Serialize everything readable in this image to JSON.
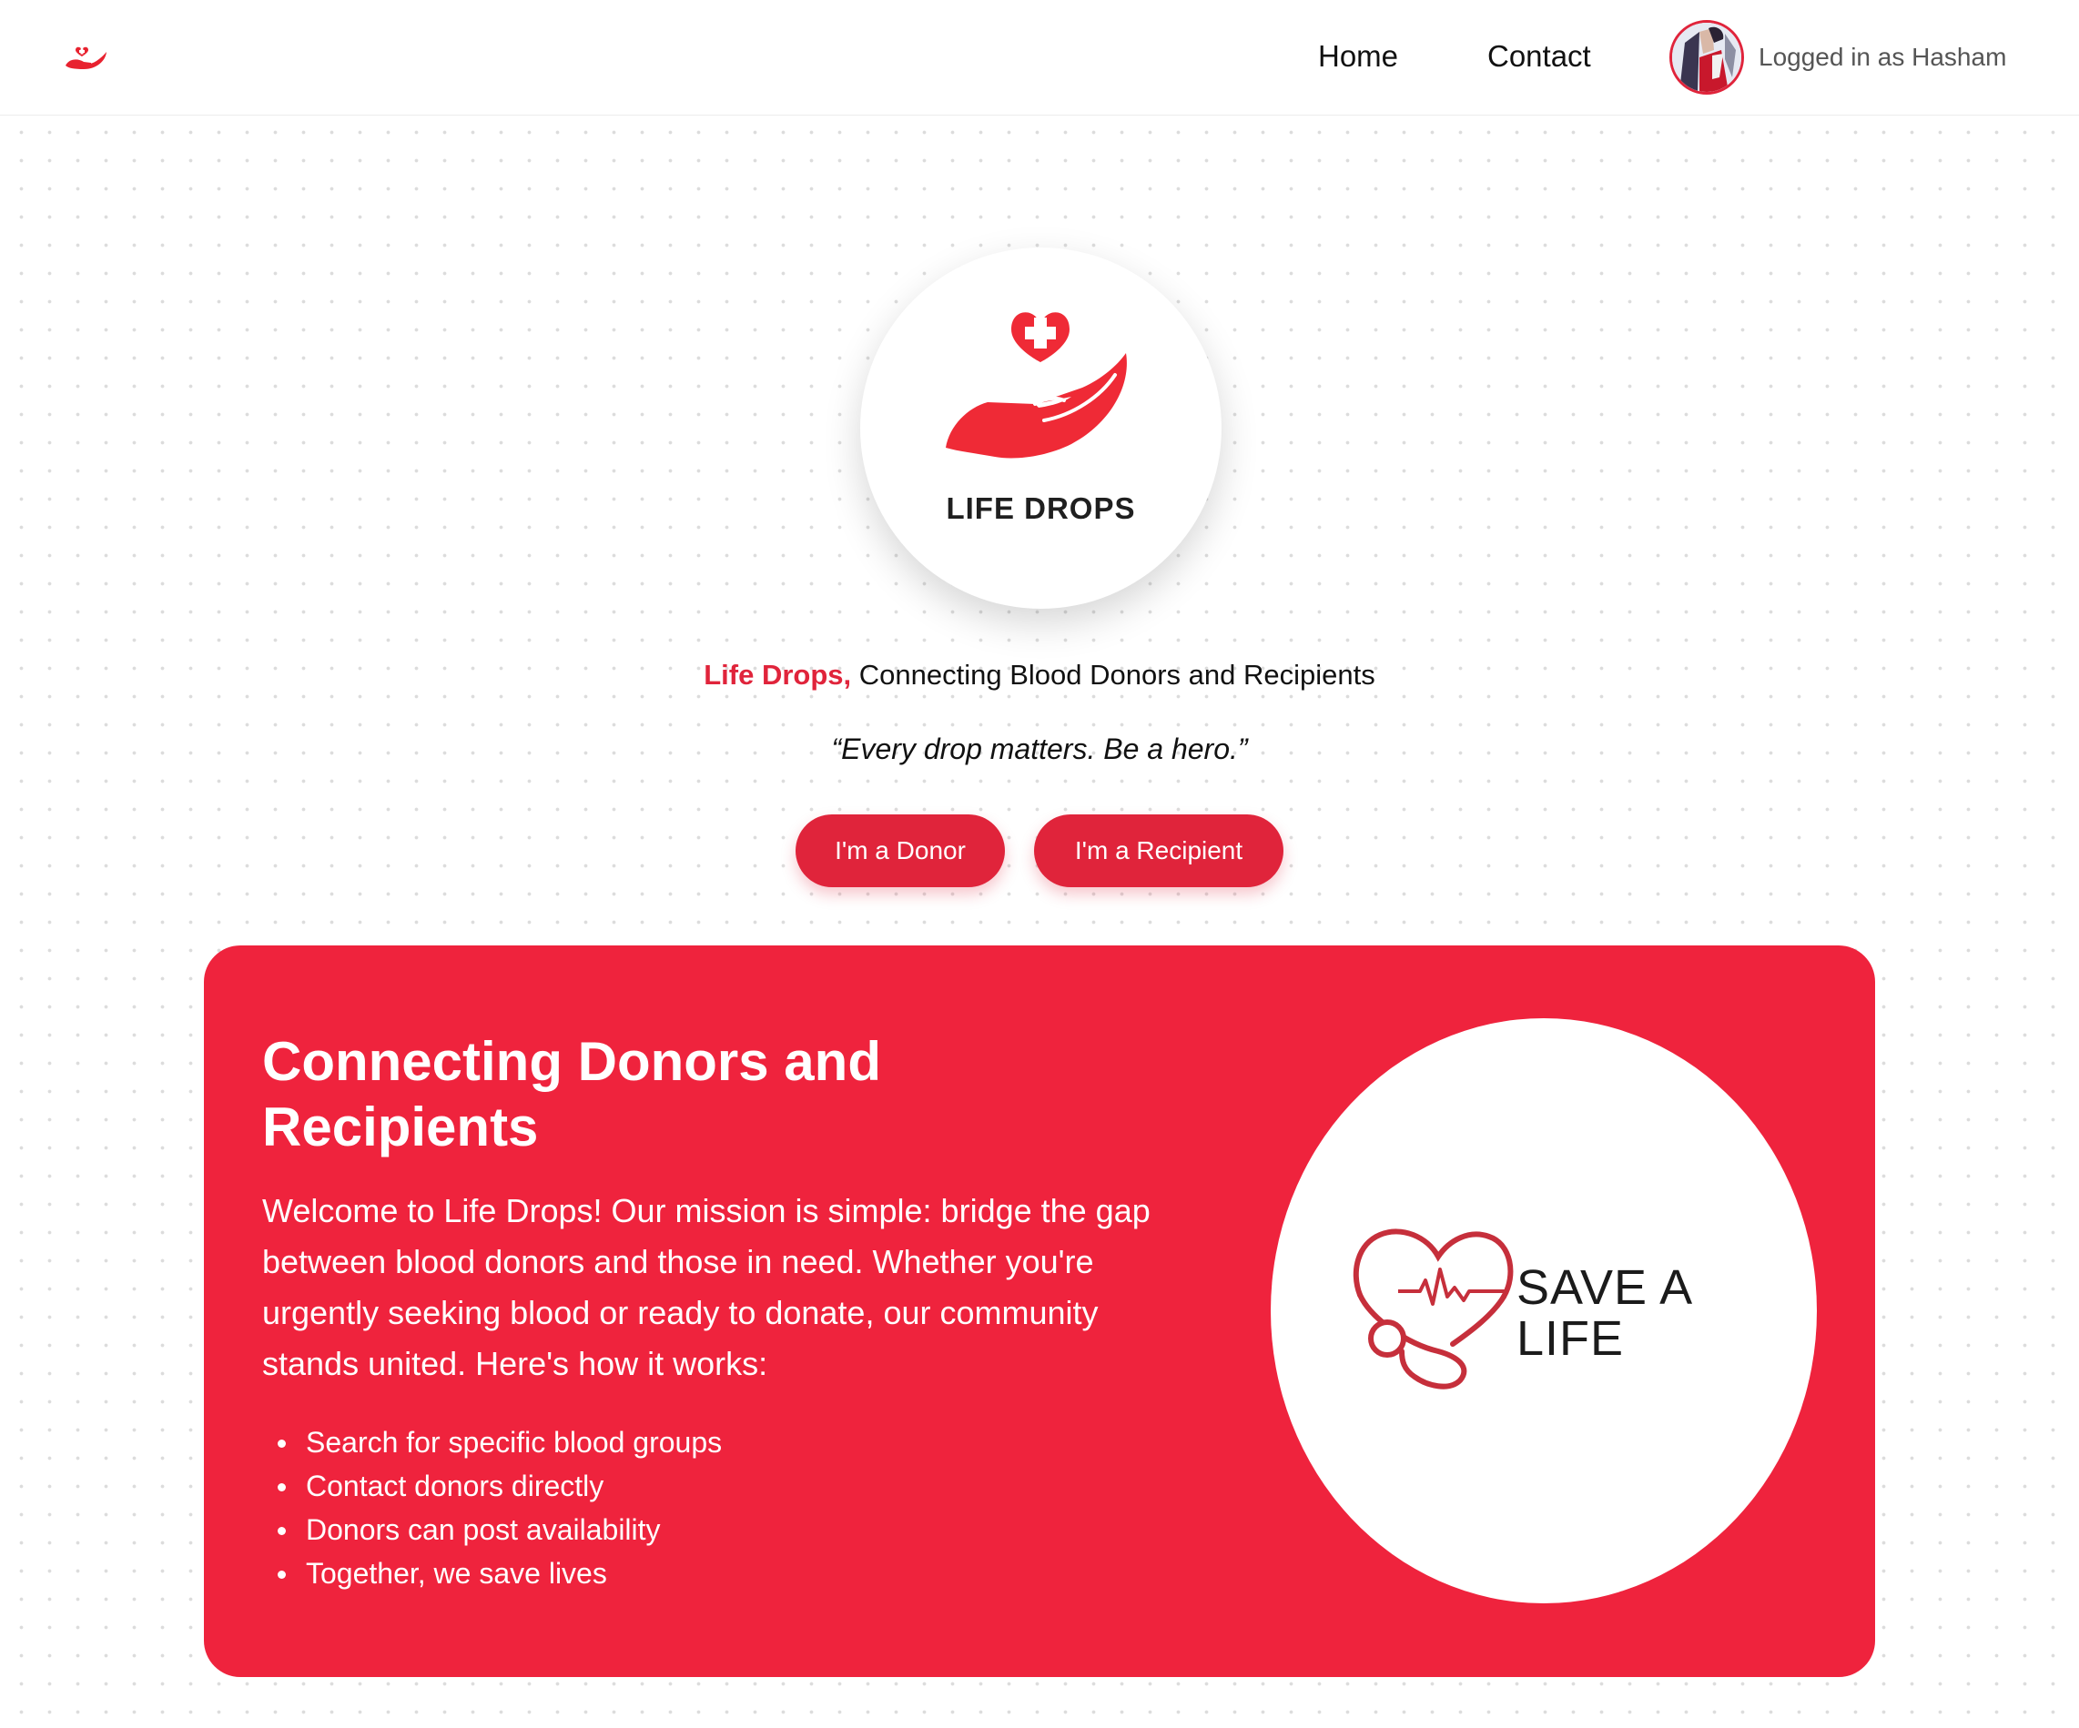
{
  "nav": {
    "home": "Home",
    "contact": "Contact",
    "user_label": "Logged in as Hasham"
  },
  "hero": {
    "logo_text": "LIFE DROPS",
    "brand": "Life Drops,",
    "tagline": "Connecting Blood Donors and Recipients",
    "quote": "“Every drop matters. Be a hero.”",
    "donor_button": "I'm a Donor",
    "recipient_button": "I'm a Recipient"
  },
  "card": {
    "title": "Connecting Donors and Recipients",
    "body": "Welcome to Life Drops! Our mission is simple: bridge the gap between blood donors and those in need. Whether you're urgently seeking blood or ready to donate, our community stands united. Here's how it works:",
    "items": [
      "Search for specific blood groups",
      "Contact donors directly",
      "Donors can post availability",
      "Together, we save lives"
    ],
    "image_text": "SAVE A LIFE"
  },
  "colors": {
    "brand_red": "#e0243b",
    "card_red": "#ef233d"
  },
  "icons": {
    "nav_logo": "heart-hand-icon",
    "hero_logo": "heart-hand-logo",
    "save_art": "heart-stethoscope-icon",
    "avatar": "user-avatar"
  }
}
